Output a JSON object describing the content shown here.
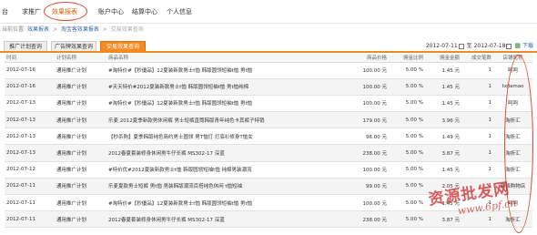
{
  "nav": {
    "items": [
      "台",
      "求推广",
      "效果报表",
      "账户中心",
      "结算中心",
      "个人信息"
    ],
    "active": 2
  },
  "breadcrumb": {
    "prefix": "当前位置:",
    "items": [
      "效果报表",
      "淘宝客效果报表",
      "交易效果查询"
    ]
  },
  "tabs": [
    "推广计划查询",
    "广告牌效果查询",
    "交易效果查询"
  ],
  "active_tab": 2,
  "date_range": {
    "start": "2012-07-11",
    "sep": "至",
    "end": "2012-07-18",
    "download": "下载"
  },
  "table": {
    "headers": [
      "时间",
      "计划名称",
      "商品名称",
      "商品价格",
      "佣金比例",
      "佣金金额",
      "成交笔数",
      "店铺昵称"
    ],
    "rows": [
      [
        "2012-07-16",
        "通用推广计划",
        "#淘特价#【秒優品】12夏装新款男士t恤 韩版圆领短袖t恤 男t恤",
        "100.00 元",
        "5.00 %",
        "1.45 元",
        "1",
        "呵呵"
      ],
      [
        "2012-07-16",
        "通用推广计划",
        "#天天特价#2012夏装新款男士t恤 韩版圆领短袖t恤 男t恤纯棉",
        "100.00 元",
        "5.00 %",
        "1.45 元",
        "1",
        "txjiamao"
      ],
      [
        "2012-07-13",
        "通用推广计划",
        "#淘特价#【秒優品】12夏装新款男士t恤 韩版圆领短袖t恤 男t恤",
        "100.00 元",
        "5.00 %",
        "1.45 元",
        "1",
        "呵呵"
      ],
      [
        "2012-07-13",
        "通用推广计划",
        "乐麦 2012夏季新款男休闲裤 男士短裤直筒韩版青年纯色卡其裤子特销",
        "179.00 元",
        "5.00 %",
        "3.96 元",
        "1",
        "淘折汇"
      ],
      [
        "2012-07-13",
        "通用推广计划",
        "【秒杀购】夏季韩版纯色简约男士圆领 男T恤打 打底衫修身T恤女",
        "96.00 元",
        "5.00 %",
        "1.49 元",
        "1",
        "淘折汇"
      ],
      [
        "2012-07-13",
        "通用推广计划",
        "2012春夏套装修身休闲男牛仔长裤 MS302-17 深蓝",
        "238.00 元",
        "5.00 %",
        "3.87 元",
        "1",
        "淘折汇"
      ],
      [
        "2012-07-12",
        "通用推广计划",
        "#特价优#2012夏装新款男士t恤 韩版圆领短袖t恤 纯棉男装潮流",
        "100.00 元",
        "5.00 %",
        "1.45 元",
        "1",
        "淘折汇"
      ],
      [
        "2012-07-11",
        "通用推广计划",
        "乐麦夏款男士短裤 男t恤 男装韩版潮流百搭纯色休闲 t恤短袖",
        "99.00 元",
        "5.00 %",
        "2.05 元",
        "1",
        "网络购物店"
      ],
      [
        "2012-07-11",
        "通用推广计划",
        "#淘特价#【秒優品】12夏装新款男士t恤 韩版圆领短袖t恤 男t恤",
        "100.00 元",
        "5.00 %",
        "1.45 元",
        "1",
        "呵呵"
      ],
      [
        "2012-07-11",
        "通用推广计划",
        "2012春夏套装修身休闲男牛仔长裤 MS302-17 深蓝",
        "238.00 元",
        "5.00 %",
        "3.87 元",
        "1",
        "淘折汇"
      ]
    ]
  },
  "watermark": {
    "line1": "资源批发网",
    "line2": "www.6pf.cn"
  },
  "colors": {
    "accent": "#f28a24",
    "link": "#3366aa",
    "annotation": "#d84a2a"
  }
}
